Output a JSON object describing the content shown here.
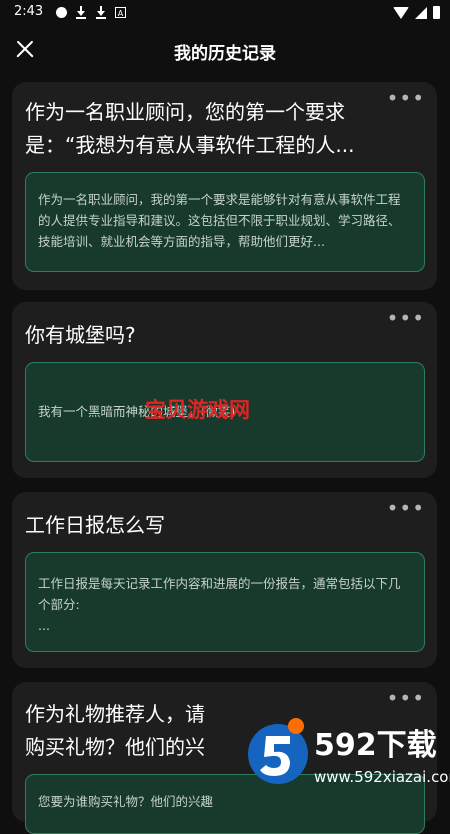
{
  "status_bar": {
    "time": "2:43",
    "right_icons": [
      "wifi-icon",
      "signal-icon",
      "battery-icon"
    ],
    "left_icons": [
      "dot-icon",
      "download-icon",
      "download-icon",
      "a-icon"
    ]
  },
  "header": {
    "title": "我的历史记录",
    "close_icon": "close-icon"
  },
  "cards": [
    {
      "question": "作为一名职业顾问，您的第一个要求是：“我想为有意从事软件工程的人...",
      "reply": "作为一名职业顾问，我的第一个要求是能够针对有意从事软件工程的人提供专业指导和建议。这包括但不限于职业规划、学习路径、技能培训、就业机会等方面的指导，帮助他们更好..."
    },
    {
      "question": "你有城堡吗?",
      "reply": "我有一个黑暗而神秘的城堡。(微笑)"
    },
    {
      "question": "工作日报怎么写",
      "reply": "工作日报是每天记录工作内容和进展的一份报告，通常包括以下几个部分:\n..."
    },
    {
      "question": "作为礼物推荐人，请购买礼物？他们的兴",
      "reply": "您要为谁购买礼物？他们的兴趣"
    }
  ],
  "more_label": "•••",
  "watermarks": {
    "center": "宝贝游戏网",
    "brand": "592下载",
    "url": "www.592xiazai.com"
  },
  "colors": {
    "background": "#0f0f0f",
    "card": "#1e1e1e",
    "reply_bg": "#173a2d",
    "reply_border": "#2f7d5c"
  }
}
